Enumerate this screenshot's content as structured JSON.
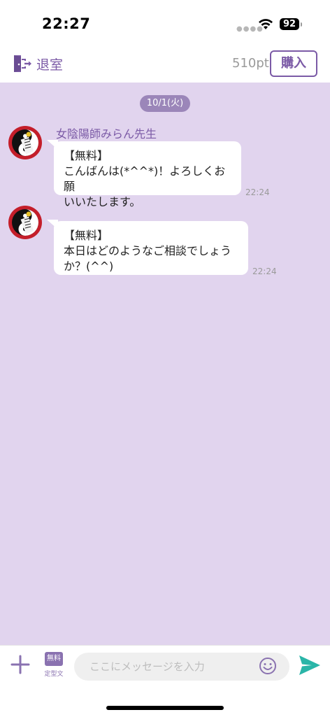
{
  "status_bar": {
    "time": "22:27",
    "battery": "92"
  },
  "header": {
    "exit_label": "退室",
    "points": "510pt",
    "buy_label": "購入"
  },
  "chat": {
    "date": "10/1(火)",
    "sender_name": "女陰陽師みらん先生",
    "messages": [
      {
        "line1": "【無料】",
        "line2": "こんばんは(*^^*)！よろしくお願",
        "line3": "いいたします。",
        "time": "22:24"
      },
      {
        "line1": "【無料】",
        "line2": "本日はどのようなご相談でしょう",
        "line3": "か？(^^)",
        "time": "22:24"
      }
    ]
  },
  "input_bar": {
    "preset_badge": "無料",
    "preset_label": "定型文",
    "placeholder": "ここにメッセージを入力"
  },
  "colors": {
    "accent": "#7b5aa6",
    "chat_bg": "#e1d4ee",
    "send": "#2ab5a8"
  }
}
